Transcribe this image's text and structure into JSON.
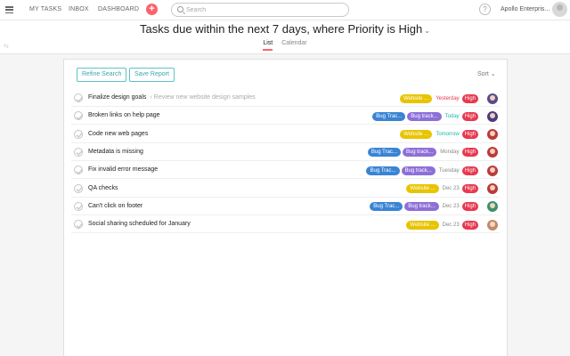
{
  "nav": {
    "my_tasks": "MY TASKS",
    "inbox": "INBOX",
    "dashboard": "DASHBOARD",
    "add": "+",
    "search_placeholder": "Search",
    "help": "?",
    "org": "Apollo Enterpris..."
  },
  "header": {
    "title": "Tasks due within the next 7 days, where Priority is High",
    "title_chevron": "⌄",
    "tabs": [
      {
        "label": "List",
        "active": true
      },
      {
        "label": "Calendar",
        "active": false
      }
    ]
  },
  "panel": {
    "refine_label": "Refine Search",
    "save_label": "Save Report",
    "sort_label": "Sort ⌄"
  },
  "colors": {
    "website": "#e8c400",
    "bug1": "#3a84d3",
    "bug2": "#8d6fd8",
    "high": "#e8384f",
    "yesterday": "#e8384f",
    "today": "#1cb8a8",
    "tomorrow": "#1cb8a8",
    "default_date": "#888888"
  },
  "tasks": [
    {
      "name": "Finalize design goals",
      "parent": "‹ Review new website design samples",
      "tags": [
        {
          "label": "Website ...",
          "color": "#e8c400"
        }
      ],
      "due": "Yesterday",
      "due_color": "#e8384f",
      "priority": "High",
      "avatar_color": "#5a4a8a"
    },
    {
      "name": "Broken links on help page",
      "parent": "",
      "tags": [
        {
          "label": "Bug Trac...",
          "color": "#3a84d3"
        },
        {
          "label": "Bug track...",
          "color": "#8d6fd8"
        }
      ],
      "due": "Today",
      "due_color": "#1cb8a8",
      "priority": "High",
      "avatar_color": "#4b3d7a"
    },
    {
      "name": "Code new web pages",
      "parent": "",
      "tags": [
        {
          "label": "Website ...",
          "color": "#e8c400"
        }
      ],
      "due": "Tomorrow",
      "due_color": "#1cb8a8",
      "priority": "High",
      "avatar_color": "#b83b3b"
    },
    {
      "name": "Metadata is missing",
      "parent": "",
      "tags": [
        {
          "label": "Bug Trac...",
          "color": "#3a84d3"
        },
        {
          "label": "Bug track...",
          "color": "#8d6fd8"
        }
      ],
      "due": "Monday",
      "due_color": "#888888",
      "priority": "High",
      "avatar_color": "#b83b3b"
    },
    {
      "name": "Fix invalid error message",
      "parent": "",
      "tags": [
        {
          "label": "Bug Trac...",
          "color": "#3a84d3"
        },
        {
          "label": "Bug track...",
          "color": "#8d6fd8"
        }
      ],
      "due": "Tuesday",
      "due_color": "#888888",
      "priority": "High",
      "avatar_color": "#b83b3b"
    },
    {
      "name": "QA checks",
      "parent": "",
      "tags": [
        {
          "label": "Website ...",
          "color": "#e8c400"
        }
      ],
      "due": "Dec 23",
      "due_color": "#888888",
      "priority": "High",
      "avatar_color": "#b83b3b"
    },
    {
      "name": "Can't click on footer",
      "parent": "",
      "tags": [
        {
          "label": "Bug Trac...",
          "color": "#3a84d3"
        },
        {
          "label": "Bug track...",
          "color": "#8d6fd8"
        }
      ],
      "due": "Dec 23",
      "due_color": "#888888",
      "priority": "High",
      "avatar_color": "#3f8f6a"
    },
    {
      "name": "Social sharing scheduled for January",
      "parent": "",
      "tags": [
        {
          "label": "Website ...",
          "color": "#e8c400"
        }
      ],
      "due": "Dec 23",
      "due_color": "#888888",
      "priority": "High",
      "avatar_color": "#c28a6a"
    }
  ]
}
